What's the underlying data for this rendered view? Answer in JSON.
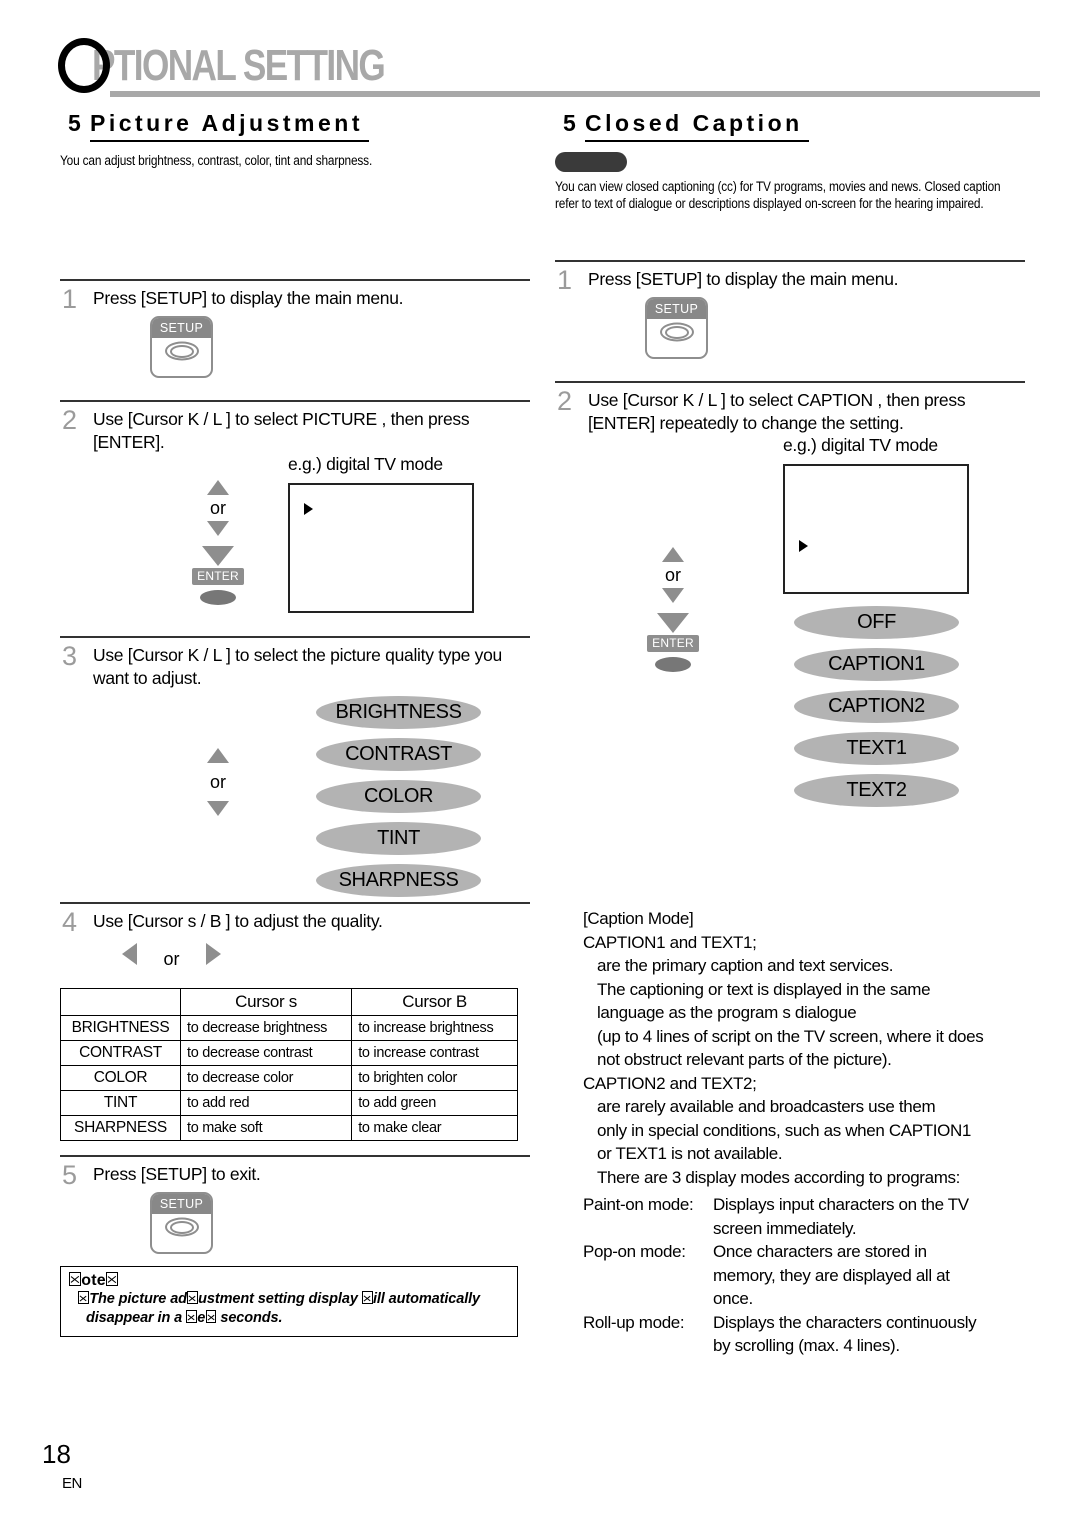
{
  "chapter": {
    "initial": "O",
    "rest": "PTIONAL SETTING"
  },
  "left": {
    "heading": {
      "mark": "5",
      "title": "Picture Adjustment"
    },
    "intro": "You can adjust brightness, contrast, color, tint and sharpness.",
    "steps": [
      {
        "num": "1",
        "text": "Press [SETUP] to display the main menu."
      },
      {
        "num": "2",
        "text": "Use [Cursor K / L ] to select  PICTURE , then press [ENTER]."
      },
      {
        "num": "3",
        "text": "Use [Cursor K / L ] to select the picture quality type you want to adjust."
      },
      {
        "num": "4",
        "text": "Use [Cursor s  / B ] to adjust the quality."
      },
      {
        "num": "5",
        "text": "Press [SETUP] to exit."
      }
    ],
    "setup_key_label": "SETUP",
    "enter_label": "ENTER",
    "or_label": "or",
    "eg_label": "e.g.) digital TV mode",
    "quality_options": [
      "BRIGHTNESS",
      "CONTRAST",
      "COLOR",
      "TINT",
      "SHARPNESS"
    ],
    "table": {
      "headers": [
        "",
        "Cursor s",
        "Cursor B"
      ],
      "rows": [
        [
          "BRIGHTNESS",
          "to decrease brightness",
          "to increase brightness"
        ],
        [
          "CONTRAST",
          "to decrease contrast",
          "to increase contrast"
        ],
        [
          "COLOR",
          "to decrease color",
          "to brighten color"
        ],
        [
          "TINT",
          "to add red",
          "to add green"
        ],
        [
          "SHARPNESS",
          "to make soft",
          "to make clear"
        ]
      ]
    },
    "note": {
      "title_pre": "",
      "title": "ote",
      "body_line1": "The picture ad",
      "body_line1b": "ustment setting display ",
      "body_line1c": "ill automatically",
      "body_line2a": "disappear in a ",
      "body_line2b": "e",
      "body_line2c": " seconds."
    }
  },
  "right": {
    "heading": {
      "mark": "5",
      "title": "Closed Caption"
    },
    "intro": "You can view closed captioning (cc) for TV programs, movies and news. Closed caption refer to text of dialogue or descriptions displayed on-screen for the hearing impaired.",
    "steps": [
      {
        "num": "1",
        "text": "Press [SETUP] to display the main menu."
      },
      {
        "num": "2",
        "text": "Use [Cursor K / L ] to select  CAPTION , then press [ENTER] repeatedly to change the setting."
      }
    ],
    "setup_key_label": "SETUP",
    "enter_label": "ENTER",
    "or_label": "or",
    "eg_label": "e.g.) digital TV mode",
    "caption_options": [
      "OFF",
      "CAPTION1",
      "CAPTION2",
      "TEXT1",
      "TEXT2"
    ],
    "caption_mode": {
      "title": "[Caption Mode]",
      "group1_head": "CAPTION1 and TEXT1;",
      "group1_lines": [
        "are the primary caption and text services.",
        "The captioning or text is displayed in the same",
        "language as the program s dialogue",
        "(up to 4 lines of script on the TV screen, where it does",
        "not obstruct relevant parts of the picture)."
      ],
      "group2_head": "CAPTION2 and TEXT2;",
      "group2_lines": [
        "are rarely available and broadcasters use them",
        "only in special conditions, such as when  CAPTION1",
        "or  TEXT1  is not available.",
        "There are 3 display modes according to programs:"
      ],
      "modes": [
        {
          "name": "Paint-on mode:",
          "lines": [
            "Displays input characters on the TV",
            "screen immediately."
          ]
        },
        {
          "name": "Pop-on mode:",
          "lines": [
            "Once characters are stored in",
            "memory, they are displayed all at",
            "once."
          ]
        },
        {
          "name": "Roll-up mode:",
          "lines": [
            "Displays the characters continuously",
            "by scrolling (max. 4 lines)."
          ]
        }
      ]
    }
  },
  "footer": {
    "page": "18",
    "lang": "EN"
  }
}
